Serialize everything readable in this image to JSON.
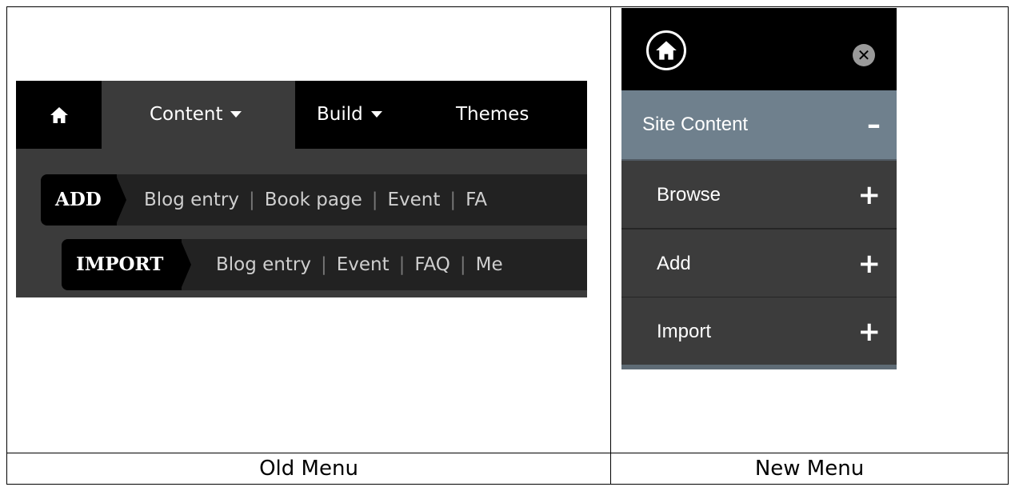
{
  "old_menu": {
    "tabs": [
      {
        "label": "Content"
      },
      {
        "label": "Build"
      },
      {
        "label": "Themes"
      }
    ],
    "add_row": {
      "head": "ADD",
      "links": [
        "Blog entry",
        "Book page",
        "Event",
        "FA"
      ]
    },
    "import_row": {
      "head": "IMPORT",
      "links": [
        "Blog entry",
        "Event",
        "FAQ",
        "Me"
      ]
    }
  },
  "new_menu": {
    "close_symbol": "✕",
    "section_label": "Site Content",
    "section_sign": "–",
    "items": [
      {
        "label": "Browse",
        "sign": "+"
      },
      {
        "label": "Add",
        "sign": "+"
      },
      {
        "label": "Import",
        "sign": "+"
      }
    ]
  },
  "captions": {
    "old": "Old Menu",
    "new": "New Menu"
  },
  "colors": {
    "section_bg": "#6f808d",
    "menu_dark": "#3c3c3c"
  }
}
